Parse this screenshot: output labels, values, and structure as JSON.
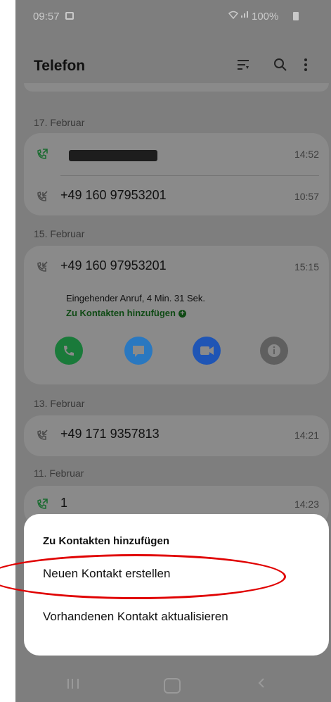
{
  "status_bar": {
    "time": "09:57",
    "battery": "100%",
    "icons": [
      "gallery-icon",
      "wifi-icon",
      "signal-icon",
      "battery-icon"
    ]
  },
  "header": {
    "title": "Telefon",
    "icons": [
      "filter-icon",
      "search-icon",
      "more-vertical-icon"
    ]
  },
  "sections": [
    {
      "date": "17. Februar",
      "calls": [
        {
          "type": "outgoing",
          "number": "",
          "redacted": true,
          "time": "14:52"
        },
        {
          "type": "incoming",
          "number": "+49 160 97953201",
          "time": "10:57"
        }
      ]
    },
    {
      "date": "15. Februar",
      "calls": [
        {
          "type": "incoming",
          "number": "+49 160 97953201",
          "time": "15:15",
          "detail": "Eingehender Anruf, 4 Min. 31 Sek.",
          "add_link": "Zu Kontakten hinzufügen",
          "actions": [
            "call-icon",
            "message-icon",
            "video-call-icon",
            "info-icon"
          ]
        }
      ]
    },
    {
      "date": "13. Februar",
      "calls": [
        {
          "type": "incoming",
          "number": "+49 171 9357813",
          "time": "14:21"
        }
      ]
    },
    {
      "date": "11. Februar",
      "calls": [
        {
          "type": "outgoing",
          "number": "1",
          "time": "14:23"
        }
      ]
    }
  ],
  "sheet": {
    "title": "Zu Kontakten hinzufügen",
    "options": [
      "Neuen Kontakt erstellen",
      "Vorhandenen Kontakt aktualisieren"
    ]
  },
  "colors": {
    "dim_overlay": "#7e7e7e",
    "card": "#8a8a8a",
    "link_green": "#0f4a14",
    "call_green": "#1a7a3a",
    "message_blue": "#2a78c0",
    "video_blue": "#1f55b5",
    "info_gray": "#5f5f5f",
    "highlight_red": "#e00000"
  },
  "nav_bar": [
    "recent-apps-icon",
    "home-icon",
    "back-icon"
  ]
}
